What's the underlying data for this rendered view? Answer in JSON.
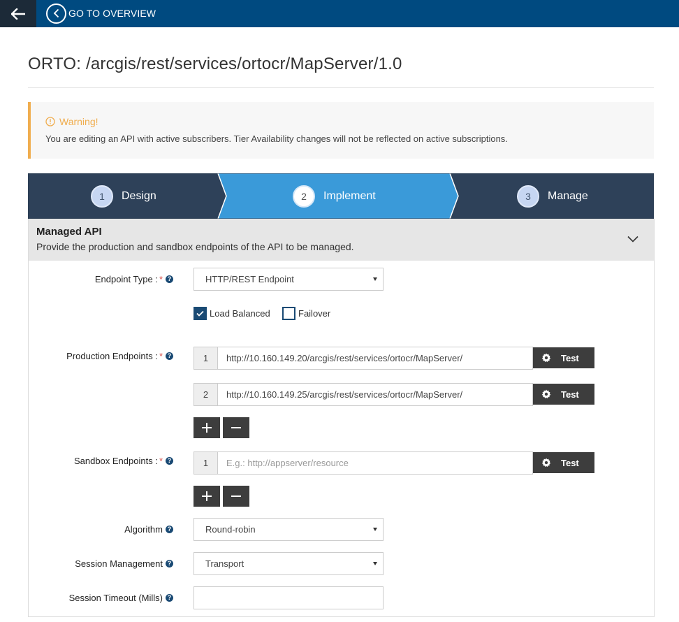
{
  "topbar": {
    "overview_label": "GO TO OVERVIEW"
  },
  "page": {
    "title": "ORTO: /arcgis/rest/services/ortocr/MapServer/1.0"
  },
  "warning": {
    "title": "Warning!",
    "message": "You are editing an API with active subscribers. Tier Availability changes will not be reflected on active subscriptions."
  },
  "wizard": {
    "steps": [
      {
        "number": "1",
        "label": "Design",
        "active": false
      },
      {
        "number": "2",
        "label": "Implement",
        "active": true
      },
      {
        "number": "3",
        "label": "Manage",
        "active": false
      }
    ]
  },
  "panel": {
    "title": "Managed API",
    "subtitle": "Provide the production and sandbox endpoints of the API to be managed."
  },
  "form": {
    "endpoint_type": {
      "label": "Endpoint Type :",
      "required_mark": "*",
      "value": "HTTP/REST Endpoint"
    },
    "load_balanced": {
      "label": "Load Balanced",
      "checked": true
    },
    "failover": {
      "label": "Failover",
      "checked": false
    },
    "production": {
      "label": "Production Endpoints :",
      "required_mark": "*",
      "endpoints": [
        {
          "number": "1",
          "value": "http://10.160.149.20/arcgis/rest/services/ortocr/MapServer/"
        },
        {
          "number": "2",
          "value": "http://10.160.149.25/arcgis/rest/services/ortocr/MapServer/"
        }
      ]
    },
    "sandbox": {
      "label": "Sandbox Endpoints :",
      "required_mark": "*",
      "endpoints": [
        {
          "number": "1",
          "value": "",
          "placeholder": "E.g.: http://appserver/resource"
        }
      ]
    },
    "test_label": "Test",
    "algorithm": {
      "label": "Algorithm",
      "value": "Round-robin"
    },
    "session_management": {
      "label": "Session Management",
      "value": "Transport"
    },
    "session_timeout": {
      "label": "Session Timeout (Mills)",
      "value": ""
    },
    "help_glyph": "?"
  },
  "colors": {
    "topbar": "#004a80",
    "back_button": "#1c2a38",
    "wizard_inactive": "#2e4159",
    "wizard_active": "#3a9ad9",
    "warning_accent": "#f0ad4e",
    "required": "#d9534f",
    "button_dark": "#3d3d3d"
  }
}
